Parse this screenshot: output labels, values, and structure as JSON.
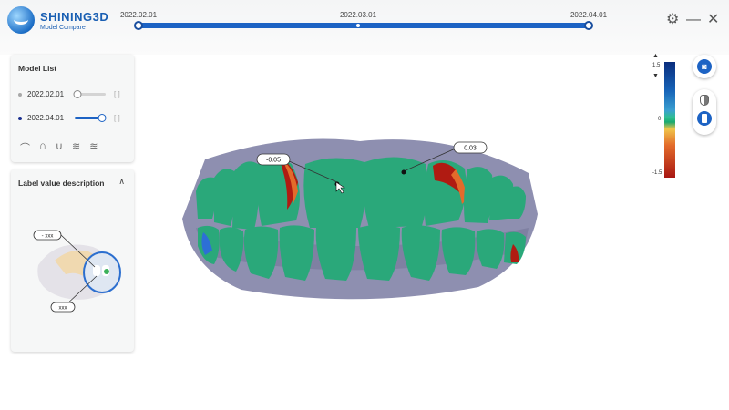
{
  "app": {
    "brand": "SHINING3D",
    "subtitle": "Model Compare"
  },
  "timeline": {
    "dates": [
      "2022.02.01",
      "2022.03.01",
      "2022.04.01"
    ]
  },
  "window_controls": {
    "settings_icon": "gear-icon",
    "minimize_icon": "minimize-icon",
    "close_icon": "close-icon"
  },
  "model_list": {
    "title": "Model List",
    "models": [
      {
        "label": "2022.02.01",
        "dot_color": "#a8a8a8",
        "opacity": 0
      },
      {
        "label": "2022.04.01",
        "dot_color": "#1a2f8f",
        "opacity": 1
      }
    ],
    "view_icons": [
      "upper-arch-icon",
      "arch-front-icon",
      "lower-arch-icon",
      "left-view-icon",
      "right-view-icon"
    ]
  },
  "label_panel": {
    "title": "Label value description",
    "callout_top": "- xxx",
    "callout_bottom": "xxx"
  },
  "color_scale": {
    "max": "1.5",
    "zero": "0",
    "min": "-1.5"
  },
  "annotations": {
    "left_value": "-0.05",
    "right_value": "0.03"
  },
  "colors": {
    "accent": "#1d63c4",
    "gum": "#8e8fb0",
    "tooth": "#2aa87a",
    "deviation_high": "#b01b12"
  }
}
